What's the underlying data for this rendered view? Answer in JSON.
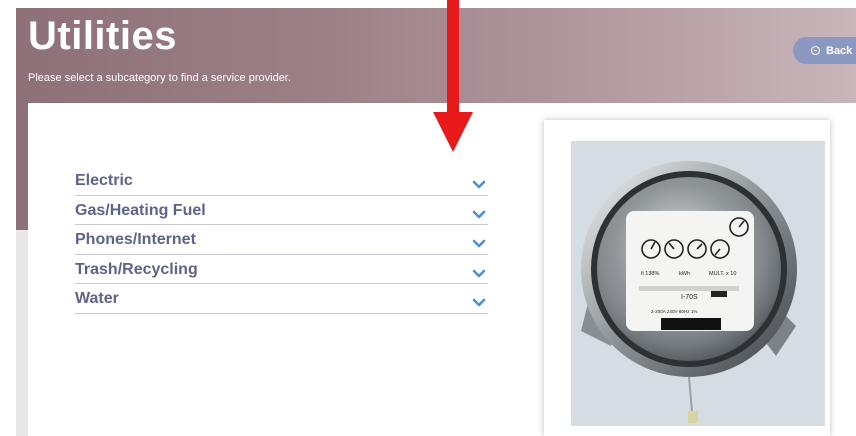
{
  "header": {
    "title": "Utilities",
    "subtitle": "Please select a subcategory to find a service provider.",
    "back_label": "Back"
  },
  "categories": [
    {
      "label": "Electric"
    },
    {
      "label": "Gas/Heating Fuel"
    },
    {
      "label": "Phones/Internet"
    },
    {
      "label": "Trash/Recycling"
    },
    {
      "label": "Water"
    }
  ],
  "meter": {
    "percent_label": "fi 138%",
    "unit_label": "kWh",
    "multiplier_label": "MULT. x 10",
    "model_label": "I-70S",
    "spec_line": "2-200A 240V 60Hz 1%"
  },
  "colors": {
    "accent_text": "#5d6488",
    "chevron": "#4f8ed3",
    "back_button": "#8b98c2",
    "arrow": "#e8191a"
  }
}
